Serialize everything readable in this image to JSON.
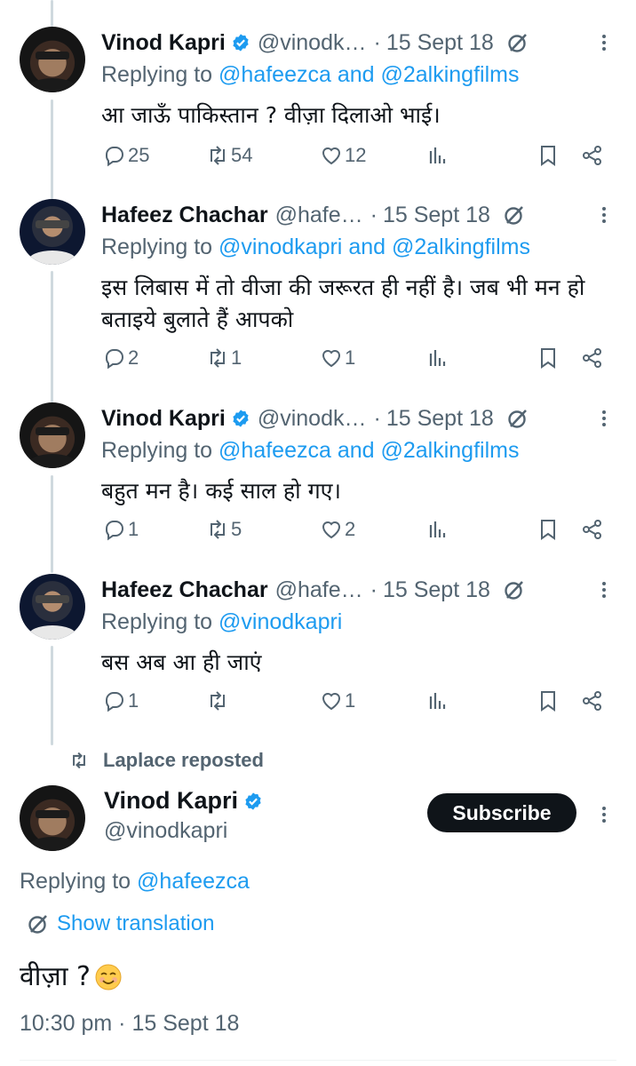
{
  "thread": [
    {
      "name": "Vinod Kapri",
      "verified": true,
      "handle": "@vinodk…",
      "dot": "·",
      "date": "15 Sept 18",
      "replying_prefix": "Replying to ",
      "mention_1": "@hafeezca",
      "and": " and ",
      "mention_2": "@2alkingfilms",
      "text": "आ जाऊँ पाकिस्तान ? वीज़ा दिलाओ भाई।",
      "replies": "25",
      "reposts": "54",
      "likes": "12",
      "avatar_icon": "avatar-vinod"
    },
    {
      "name": "Hafeez Chachar",
      "verified": false,
      "handle": "@hafe…",
      "dot": "·",
      "date": "15 Sept 18",
      "replying_prefix": "Replying to ",
      "mention_1": "@vinodkapri",
      "and": " and ",
      "mention_2": "@2alkingfilms",
      "text": "इस लिबास में तो वीजा की जरूरत ही नहीं है। जब भी मन हो बताइये बुलाते हैं आपको",
      "replies": "2",
      "reposts": "1",
      "likes": "1",
      "avatar_icon": "avatar-hafeez"
    },
    {
      "name": "Vinod Kapri",
      "verified": true,
      "handle": "@vinodk…",
      "dot": "·",
      "date": "15 Sept 18",
      "replying_prefix": "Replying to ",
      "mention_1": "@hafeezca",
      "and": " and ",
      "mention_2": "@2alkingfilms",
      "text": "बहुत मन है। कई साल हो गए।",
      "replies": "1",
      "reposts": "5",
      "likes": "2",
      "avatar_icon": "avatar-vinod"
    },
    {
      "name": "Hafeez Chachar",
      "verified": false,
      "handle": "@hafe…",
      "dot": "·",
      "date": "15 Sept 18",
      "replying_prefix": "Replying to ",
      "mention_1": "@vinodkapri",
      "and": "",
      "mention_2": "",
      "text": "बस अब आ ही जाएं",
      "replies": "1",
      "reposts": "",
      "likes": "1",
      "avatar_icon": "avatar-hafeez"
    }
  ],
  "repost_banner": {
    "text": "Laplace reposted",
    "icon": "repost-icon"
  },
  "main": {
    "name": "Vinod Kapri",
    "verified": true,
    "handle": "@vinodkapri",
    "subscribe_label": "Subscribe",
    "replying_prefix": "Replying to ",
    "mention": "@hafeezca",
    "show_translation": "Show translation",
    "text": "वीज़ा ?",
    "emoji": "smiling-face-emoji",
    "timestamp": "10:30 pm · 15 Sept 18"
  },
  "colors": {
    "accent": "#1d9bf0",
    "text": "#0f1419",
    "muted": "#536471",
    "thread_line": "#cfd9de"
  }
}
